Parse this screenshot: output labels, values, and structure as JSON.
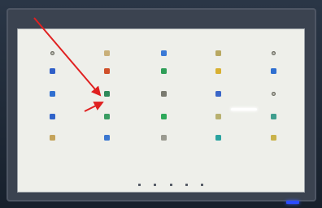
{
  "screen": {
    "status_text": "",
    "search_hint": "",
    "accent_arrow_color": "#e02020"
  },
  "apps": [
    {
      "label": "",
      "icon": "gear-icon",
      "color": "#9a9a90",
      "round": true
    },
    {
      "label": "",
      "icon": "search-icon",
      "color": "#c9b07a",
      "round": false
    },
    {
      "label": "",
      "icon": "files-icon",
      "color": "#3a79d6",
      "round": false
    },
    {
      "label": "",
      "icon": "settings-icon",
      "color": "#b8a862",
      "round": false
    },
    {
      "label": "",
      "icon": "circle-icon",
      "color": "#4a4a46",
      "round": true
    },
    {
      "label": "",
      "icon": "contacts-icon",
      "color": "#2f5fc8",
      "round": false
    },
    {
      "label": "",
      "icon": "camera-icon",
      "color": "#d0502a",
      "round": false
    },
    {
      "label": "",
      "icon": "sheets-icon",
      "color": "#2f9e58",
      "round": false
    },
    {
      "label": "",
      "icon": "star-icon",
      "color": "#d8b032",
      "round": false
    },
    {
      "label": "",
      "icon": "calendar-icon",
      "color": "#2f6fd0",
      "round": false
    },
    {
      "label": "",
      "icon": "gallery-icon",
      "color": "#2f6fd0",
      "round": false
    },
    {
      "label": "",
      "icon": "image-app-icon",
      "color": "#2e8a5a",
      "round": false
    },
    {
      "label": "",
      "icon": "maps-icon",
      "color": "#7a7a70",
      "round": false
    },
    {
      "label": "",
      "icon": "docs-icon",
      "color": "#3a66c8",
      "round": false
    },
    {
      "label": "",
      "icon": "dot-icon",
      "color": "#3a3a38",
      "round": true
    },
    {
      "label": "",
      "icon": "phone-icon",
      "color": "#2f62c9",
      "round": false
    },
    {
      "label": "",
      "icon": "plus-icon",
      "color": "#3a9d62",
      "round": false
    },
    {
      "label": "",
      "icon": "slides-icon",
      "color": "#2ea95a",
      "round": false
    },
    {
      "label": "",
      "icon": "key-icon",
      "color": "#b8b070",
      "round": false
    },
    {
      "label": "",
      "icon": "chat-icon",
      "color": "#3f9e8e",
      "round": false
    },
    {
      "label": "",
      "icon": "settings-gear-icon",
      "color": "#c4a35a",
      "round": false
    },
    {
      "label": "",
      "icon": "browser-icon",
      "color": "#3b77d0",
      "round": false
    },
    {
      "label": "",
      "icon": "line-icon",
      "color": "#9a9a90",
      "round": false
    },
    {
      "label": "",
      "icon": "store-icon",
      "color": "#2aa3a0",
      "round": false
    },
    {
      "label": "",
      "icon": "sun-icon",
      "color": "#c9b24a",
      "round": false
    }
  ],
  "navbar": [
    {
      "icon": "back-icon"
    },
    {
      "icon": "home-icon"
    },
    {
      "icon": "recents-icon"
    },
    {
      "icon": "volume-down-icon"
    },
    {
      "icon": "volume-up-icon"
    }
  ]
}
